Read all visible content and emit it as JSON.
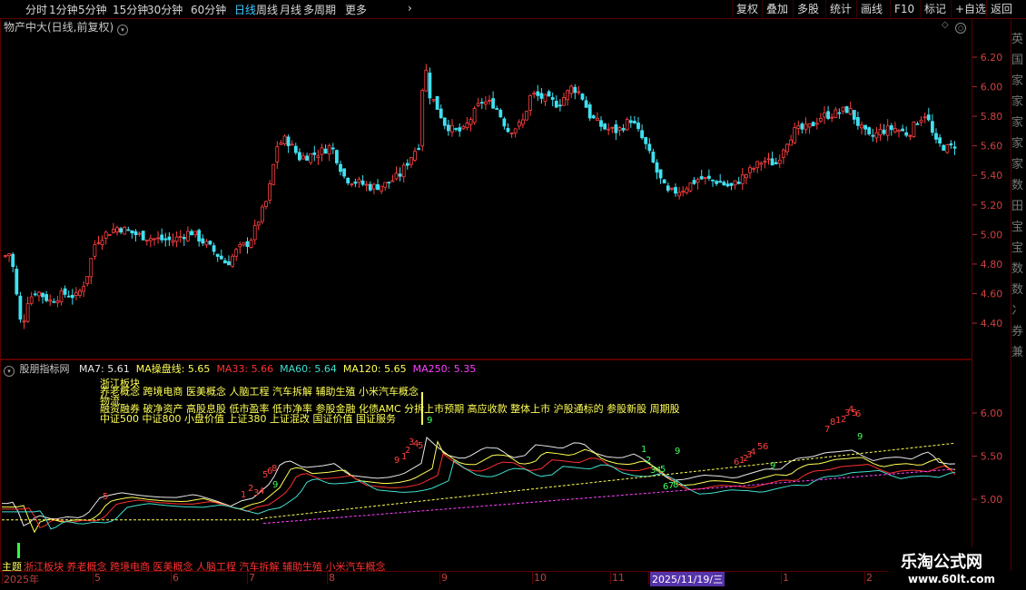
{
  "timeframes": [
    {
      "label": "分时",
      "active": false
    },
    {
      "label": "1分钟",
      "active": false
    },
    {
      "label": "5分钟",
      "active": false
    },
    {
      "label": "15分钟",
      "active": false
    },
    {
      "label": "30分钟",
      "active": false
    },
    {
      "label": "60分钟",
      "active": false
    },
    {
      "label": "日线",
      "active": true
    },
    {
      "label": "周线",
      "active": false
    },
    {
      "label": "月线",
      "active": false
    },
    {
      "label": "多周期",
      "active": false
    },
    {
      "label": "更多",
      "active": false
    }
  ],
  "toolbar": [
    "复权",
    "叠加",
    "多股",
    "统计",
    "画线",
    "F10",
    "标记",
    "+自选",
    "返回"
  ],
  "stock_title": "物产中大(日线,前复权)",
  "price_axis": [
    "6.20",
    "6.00",
    "5.80",
    "5.60",
    "5.40",
    "5.20",
    "5.00",
    "4.80",
    "4.60",
    "4.40"
  ],
  "indicator": {
    "name": "股朋指标网",
    "ma": [
      {
        "label": "MA7: 5.61",
        "color": "#e8e8e8"
      },
      {
        "label": "MA操盘线: 5.65",
        "color": "#ffff55"
      },
      {
        "label": "MA33: 5.66",
        "color": "#ff3030"
      },
      {
        "label": "MA60: 5.64",
        "color": "#40e0d0"
      },
      {
        "label": "MA120: 5.65",
        "color": "#ffff55"
      },
      {
        "label": "MA250: 5.35",
        "color": "#ff40ff"
      }
    ],
    "axis": [
      "6.00",
      "5.50",
      "5.00"
    ],
    "concepts": [
      "浙江板块",
      "养老概念 跨境电商 医美概念 人脑工程 汽车拆解 辅助生殖 小米汽车概念",
      "物流",
      "融资融券 破净资产 高股息股 低市盈率 低市净率 参股金融 化债AMC 分拆上市预期 高应收款 整体上市 沪股通标的 参股新股 周期股",
      "中证500 中证800 小盘价值 上证380 上证混改 国证价值 国证服务"
    ],
    "theme_label": "主题",
    "theme_text": "浙江板块 养老概念 跨境电商 医美概念 人脑工程 汽车拆解 辅助生殖 小米汽车概念",
    "red_marks": [
      "5",
      "1",
      "2",
      "3",
      "4",
      "5",
      "6",
      "8",
      "9",
      "1",
      "2",
      "3",
      "4",
      "5",
      "6",
      "1",
      "2",
      "3",
      "4",
      "5",
      "6",
      "7",
      "8",
      "1",
      "2",
      "3",
      "4",
      "5",
      "6",
      "7",
      "8"
    ],
    "green_marks": [
      "9",
      "9",
      "1",
      "2",
      "3",
      "4",
      "5",
      "6",
      "7",
      "8",
      "9",
      "9",
      "9"
    ]
  },
  "date_axis": [
    "2025年",
    "5",
    "6",
    "7",
    "8",
    "9",
    "10",
    "11",
    "2025/11/19/三",
    "1",
    "2"
  ],
  "right_strip": [
    "英",
    "国",
    "家",
    "家",
    "家",
    "家",
    "家",
    "数",
    "田",
    "宝",
    "宝",
    "数",
    "数",
    "冫",
    "券",
    "兼"
  ],
  "logo": {
    "title": "乐淘公式网",
    "url": "www.60lt.com"
  }
}
